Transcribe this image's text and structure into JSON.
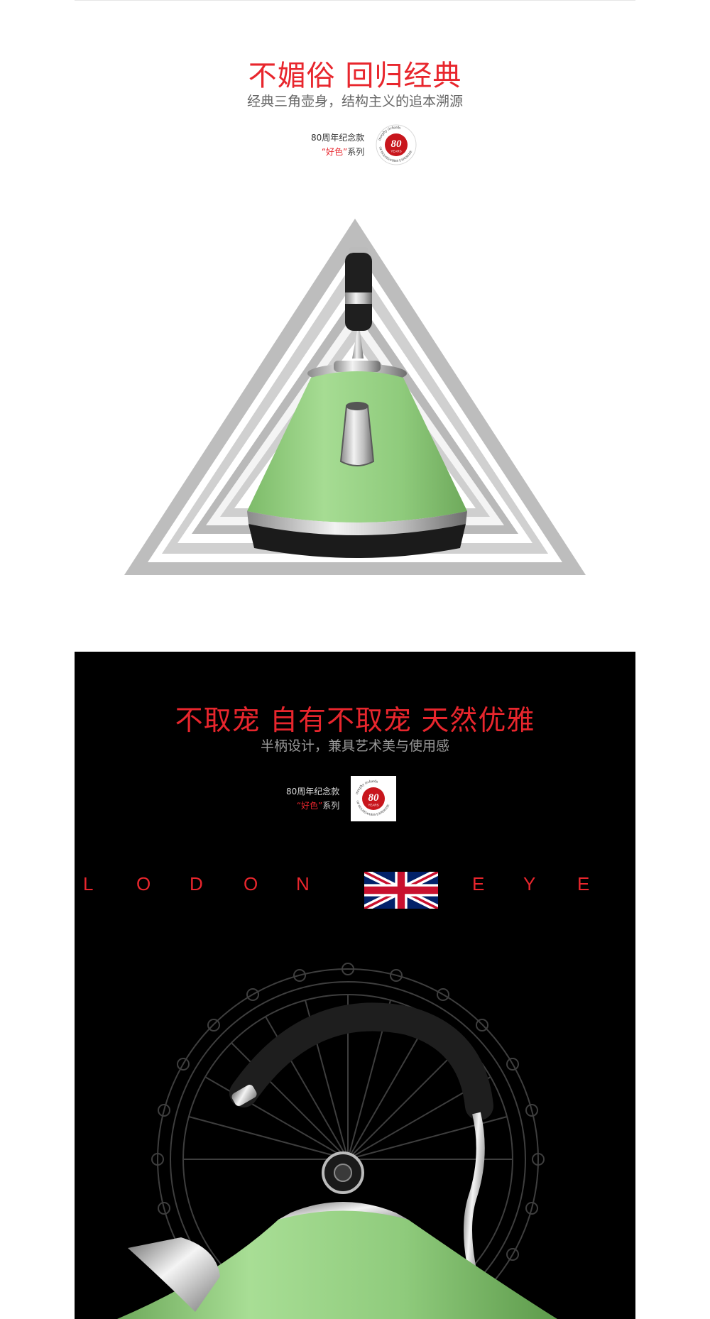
{
  "section1": {
    "title": "不媚俗  回归经典",
    "subtitle": "经典三角壶身，结构主义的追本溯源",
    "badge": {
      "line1": "80周年纪念款",
      "line2_quoted": "“好色”",
      "line2_rest": "系列",
      "seal_number": "80",
      "seal_years": "YEARS",
      "seal_brand": "morphy richards",
      "seal_ring": "OF HOUSEWARES EXPERTISE"
    },
    "kettle_color": "#8fcb7c"
  },
  "section2": {
    "title": "不取宠  自有不取宠  天然优雅",
    "subtitle": "半柄设计，兼具艺术美与使用感",
    "badge": {
      "line1": "80周年纪念款",
      "line2_quoted": "“好色”",
      "line2_rest": "系列",
      "seal_number": "80",
      "seal_years": "YEARS",
      "seal_brand": "morphy richards",
      "seal_ring": "OF HOUSEWARES EXPERTISE"
    },
    "banner_left": [
      "L",
      "O",
      "D",
      "O",
      "N"
    ],
    "banner_right": [
      "E",
      "Y",
      "E"
    ],
    "flag_icon": "union-jack-flag-icon",
    "wheel_icon": "london-eye-wheel-icon"
  },
  "colors": {
    "accent_red": "#e8262d",
    "kettle_green": "#8fcb7c",
    "section2_background": "#000000"
  }
}
